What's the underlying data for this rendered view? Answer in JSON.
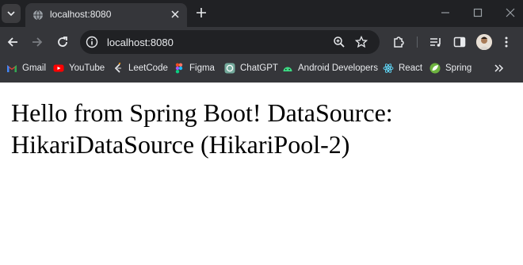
{
  "tab": {
    "title": "localhost:8080"
  },
  "address_bar": {
    "url": "localhost:8080"
  },
  "bookmarks": [
    {
      "label": "Gmail",
      "icon": "gmail-icon"
    },
    {
      "label": "YouTube",
      "icon": "youtube-icon"
    },
    {
      "label": "LeetCode",
      "icon": "leetcode-icon"
    },
    {
      "label": "Figma",
      "icon": "figma-icon"
    },
    {
      "label": "ChatGPT",
      "icon": "chatgpt-icon"
    },
    {
      "label": "Android Developers",
      "icon": "android-icon"
    },
    {
      "label": "React",
      "icon": "react-icon"
    },
    {
      "label": "Spring",
      "icon": "spring-icon"
    }
  ],
  "page": {
    "message": "Hello from Spring Boot! DataSource: HikariDataSource (HikariPool-2)"
  },
  "colors": {
    "chrome_dark": "#202124",
    "chrome_toolbar": "#35363a",
    "text_light": "#e8eaed",
    "page_bg": "#ffffff"
  }
}
